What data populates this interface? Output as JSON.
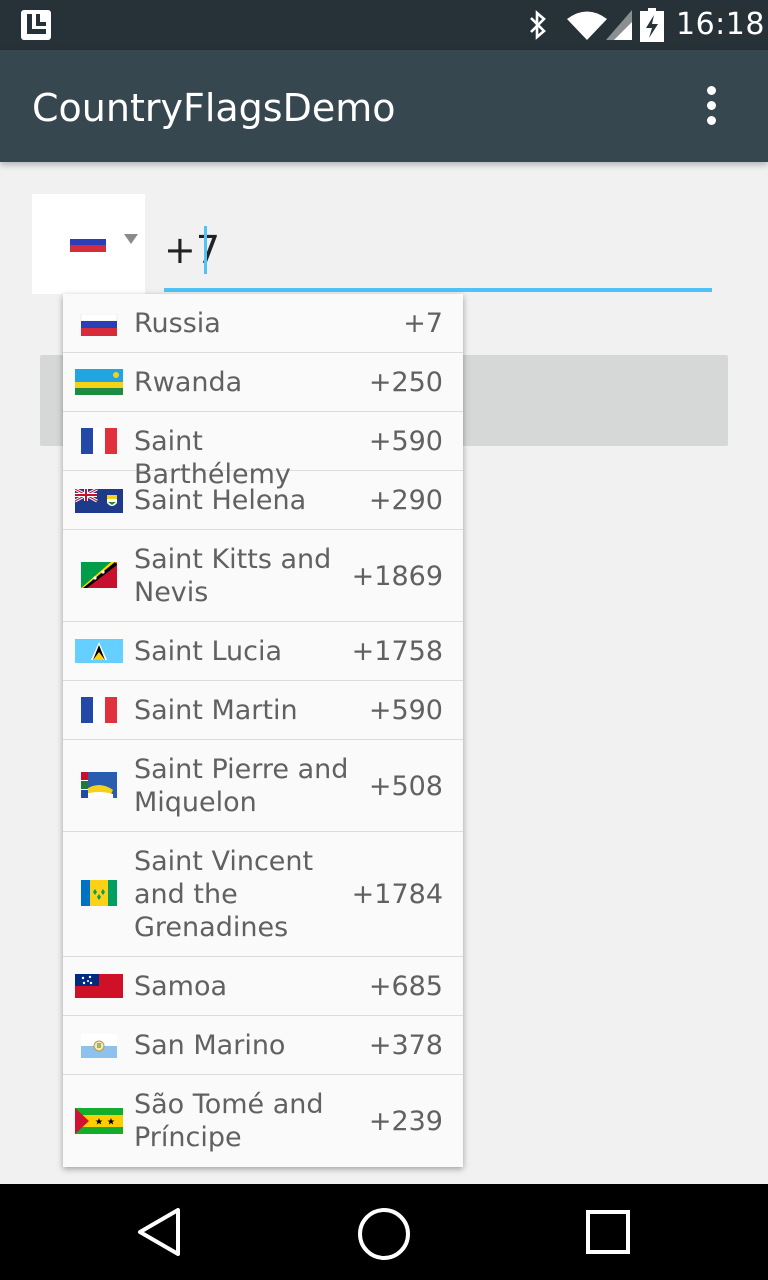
{
  "status_bar": {
    "time": "16:18",
    "icons": [
      "app-icon",
      "bluetooth-icon",
      "wifi-icon",
      "signal-icon",
      "battery-icon"
    ]
  },
  "app_bar": {
    "title": "CountryFlagsDemo",
    "overflow_icon": "more-vert-icon"
  },
  "phone_input": {
    "selected_flag": "russia-flag",
    "value": "+7"
  },
  "countries": [
    {
      "name": "Russia",
      "code": "+7",
      "flag": "russia-flag"
    },
    {
      "name": "Rwanda",
      "code": "+250",
      "flag": "rwanda-flag"
    },
    {
      "name": "Saint Barthélemy",
      "code": "+590",
      "flag": "france-flag"
    },
    {
      "name": "Saint Helena",
      "code": "+290",
      "flag": "saint-helena-flag"
    },
    {
      "name": "Saint Kitts and Nevis",
      "code": "+1869",
      "flag": "saint-kitts-flag"
    },
    {
      "name": "Saint Lucia",
      "code": "+1758",
      "flag": "saint-lucia-flag"
    },
    {
      "name": "Saint Martin",
      "code": "+590",
      "flag": "france-flag"
    },
    {
      "name": "Saint Pierre and Miquelon",
      "code": "+508",
      "flag": "saint-pierre-flag"
    },
    {
      "name": "Saint Vincent and the Grenadines",
      "code": "+1784",
      "flag": "saint-vincent-flag"
    },
    {
      "name": "Samoa",
      "code": "+685",
      "flag": "samoa-flag"
    },
    {
      "name": "San Marino",
      "code": "+378",
      "flag": "san-marino-flag"
    },
    {
      "name": "São Tomé and Príncipe",
      "code": "+239",
      "flag": "sao-tome-flag"
    }
  ],
  "nav_bar": {
    "icons": [
      "back-icon",
      "home-icon",
      "recents-icon"
    ]
  }
}
